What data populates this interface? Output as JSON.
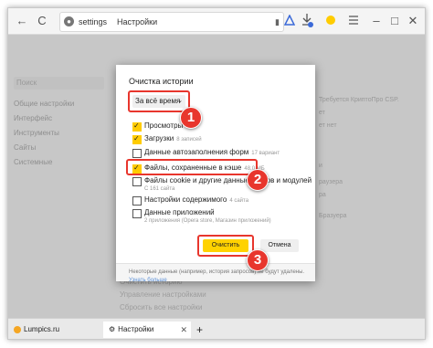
{
  "toolbar": {
    "back": "←",
    "reload": "C",
    "address_host": "settings",
    "address_title": "Настройки",
    "bookmark": "▮"
  },
  "sidebar": {
    "search": "Поиск",
    "items": [
      "Общие настройки",
      "Интерфейс",
      "Инструменты",
      "Сайты",
      "Системные"
    ]
  },
  "background": {
    "right_texts": [
      "Требуется КриптоПро CSP.",
      "ет",
      "ет нет",
      "и",
      "раузера",
      "ра",
      "Бразуера"
    ],
    "bottom_texts": [
      "Очистить историю",
      "Управление настройками",
      "Сбросить все настройки"
    ]
  },
  "dialog": {
    "title": "Очистка истории",
    "period": "За всё время",
    "options": [
      {
        "label": "Просмотры",
        "meta": "...",
        "checked": true
      },
      {
        "label": "Загрузки",
        "meta": "8 записей",
        "checked": true
      },
      {
        "label": "Данные автозаполнения форм",
        "meta": "17 вариант",
        "checked": false
      },
      {
        "label": "Файлы, сохраненные в кэше",
        "meta": "48.0 МБ",
        "checked": true
      },
      {
        "label": "Файлы cookie и другие данные сайтов и модулей",
        "sub": "С 161 сайта",
        "checked": false
      },
      {
        "label": "Настройки содержимого",
        "meta": "4 сайта",
        "checked": false
      },
      {
        "label": "Данные приложений",
        "sub": "2 приложения (Opera store, Магазин приложений)",
        "checked": false
      }
    ],
    "clear_button": "Очистить",
    "cancel_button": "Отмена",
    "footer_text": "Некоторые данные (например, история запросов) не будут удалены.",
    "footer_link": "Узнать больше"
  },
  "annotations": {
    "one": "1",
    "two": "2",
    "three": "3",
    "color": "#e8362d"
  },
  "tabs": [
    {
      "label": "Lumpics.ru",
      "icon": "lumpics-favicon"
    },
    {
      "label": "Настройки",
      "icon": "gear-icon"
    }
  ],
  "new_tab": "+"
}
